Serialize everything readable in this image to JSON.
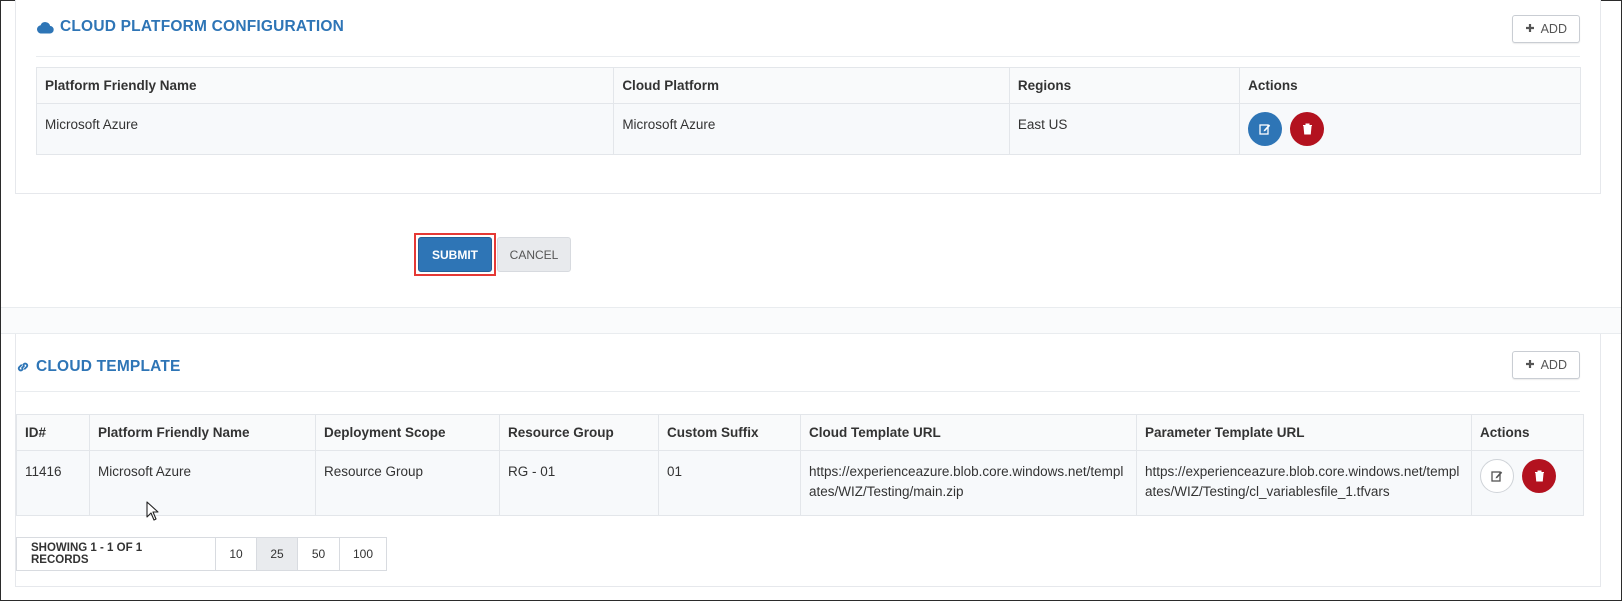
{
  "cloud_platform": {
    "title": "CLOUD PLATFORM CONFIGURATION",
    "add_label": "ADD",
    "columns": [
      "Platform Friendly Name",
      "Cloud Platform",
      "Regions",
      "Actions"
    ],
    "rows": [
      {
        "friendly_name": "Microsoft Azure",
        "platform": "Microsoft Azure",
        "regions": "East US"
      }
    ]
  },
  "form": {
    "submit_label": "SUBMIT",
    "cancel_label": "CANCEL"
  },
  "cloud_template": {
    "title": "CLOUD TEMPLATE",
    "add_label": "ADD",
    "columns": [
      "ID#",
      "Platform Friendly Name",
      "Deployment Scope",
      "Resource Group",
      "Custom Suffix",
      "Cloud Template URL",
      "Parameter Template URL",
      "Actions"
    ],
    "rows": [
      {
        "id": "11416",
        "friendly_name": "Microsoft Azure",
        "deployment_scope": "Resource Group",
        "resource_group": "RG - 01",
        "custom_suffix": "01",
        "cloud_template_url": "https://experienceazure.blob.core.windows.net/templates/WIZ/Testing/main.zip",
        "parameter_template_url": "https://experienceazure.blob.core.windows.net/templates/WIZ/Testing/cl_variablesfile_1.tfvars"
      }
    ]
  },
  "pagination": {
    "showing": "SHOWING 1 - 1 OF 1 RECORDS",
    "page_sizes": [
      "10",
      "25",
      "50",
      "100"
    ],
    "selected": "25"
  },
  "colors": {
    "accent": "#2e75b6",
    "danger": "#b3121f",
    "highlight": "#e53935"
  }
}
